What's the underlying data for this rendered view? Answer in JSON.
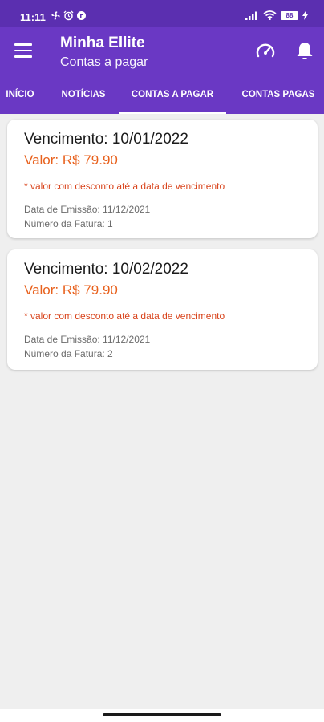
{
  "status_bar": {
    "time": "11:11",
    "left_icons": [
      "fan-icon",
      "alarm-icon",
      "app-icon"
    ],
    "right_icons": [
      "signal-icon",
      "wifi-icon"
    ],
    "battery_percent": "88"
  },
  "app_bar": {
    "title": "Minha Ellite",
    "subtitle": "Contas a pagar",
    "icons": [
      "menu-icon",
      "speedometer-icon",
      "bell-icon"
    ]
  },
  "tabs": [
    {
      "label": "INÍCIO",
      "selected": false
    },
    {
      "label": "NOTÍCIAS",
      "selected": false
    },
    {
      "label": "CONTAS A PAGAR",
      "selected": true
    },
    {
      "label": "CONTAS PAGAS",
      "selected": false
    }
  ],
  "bills": [
    {
      "due": "Vencimento: 10/01/2022",
      "value": "Valor: R$ 79.90",
      "note": "* valor com desconto até a data de vencimento",
      "emission": "Data de Emissão: 11/12/2021",
      "invoice": "Número da Fatura: 1"
    },
    {
      "due": "Vencimento: 10/02/2022",
      "value": "Valor: R$ 79.90",
      "note": "* valor com desconto até a data de vencimento",
      "emission": "Data de Emissão: 11/12/2021",
      "invoice": "Número da Fatura: 2"
    }
  ],
  "colors": {
    "primary": "#6a38c4",
    "status_bar": "#5b2fb0",
    "value_text": "#e8611d",
    "note_text": "#d9441c",
    "background": "#efefef"
  }
}
